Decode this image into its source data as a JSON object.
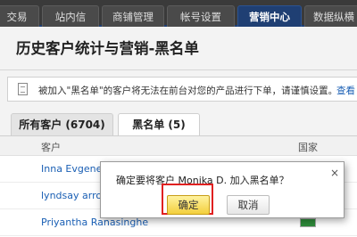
{
  "nav": {
    "tabs": [
      {
        "label": "交易"
      },
      {
        "label": "站内信"
      },
      {
        "label": "商铺管理"
      },
      {
        "label": "帐号设置"
      },
      {
        "label": "营销中心"
      },
      {
        "label": "数据纵横"
      }
    ],
    "active_index": 4
  },
  "page": {
    "title": "历史客户统计与营销-黑名单"
  },
  "notice": {
    "text": "被加入\"黑名单\"的客户将无法在前台对您的产品进行下单，请谨慎设置。",
    "link": "查看"
  },
  "sub_tabs": [
    {
      "label": "所有客户 (6704)"
    },
    {
      "label": "黑名单 (5)"
    }
  ],
  "table": {
    "columns": {
      "customer": "客户",
      "country": "国家"
    },
    "rows": [
      {
        "name": "Inna Evgenev"
      },
      {
        "name": "lyndsay arron"
      },
      {
        "name": "Priyantha Ranasinghe"
      }
    ]
  },
  "dialog": {
    "message": "确定要将客户 Monika D. 加入黑名单？",
    "close": "×",
    "ok_label": "确定",
    "cancel_label": "取消"
  },
  "colors": {
    "nav_active": "#1f3f73",
    "link": "#1a5fb4",
    "ok_button": "#f3cf3d",
    "highlight": "#e02020"
  }
}
